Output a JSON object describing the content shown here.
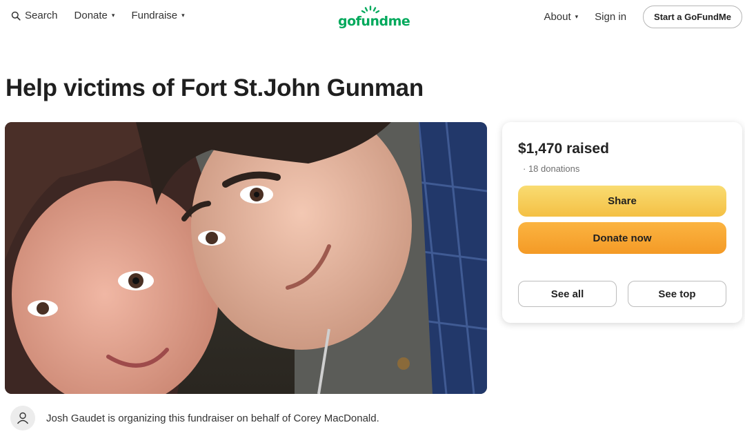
{
  "header": {
    "search_label": "Search",
    "donate_label": "Donate",
    "fundraise_label": "Fundraise",
    "caret": "▾",
    "logo_text": "gofundme",
    "about_label": "About",
    "signin_label": "Sign in",
    "start_label": "Start a GoFundMe"
  },
  "page": {
    "title": "Help victims of Fort St.John Gunman"
  },
  "card": {
    "raised": "$1,470 raised",
    "donations": "· 18 donations",
    "share_label": "Share",
    "donate_label": "Donate now",
    "see_all_label": "See all",
    "see_top_label": "See top"
  },
  "organizer": {
    "text": "Josh Gaudet is organizing this fundraiser on behalf of Corey MacDonald."
  },
  "colors": {
    "brand_green": "#02a95c",
    "share_yellow": "#f4c044",
    "donate_orange": "#f49a26"
  },
  "icons": {
    "search": "search-icon",
    "avatar": "user-icon"
  }
}
